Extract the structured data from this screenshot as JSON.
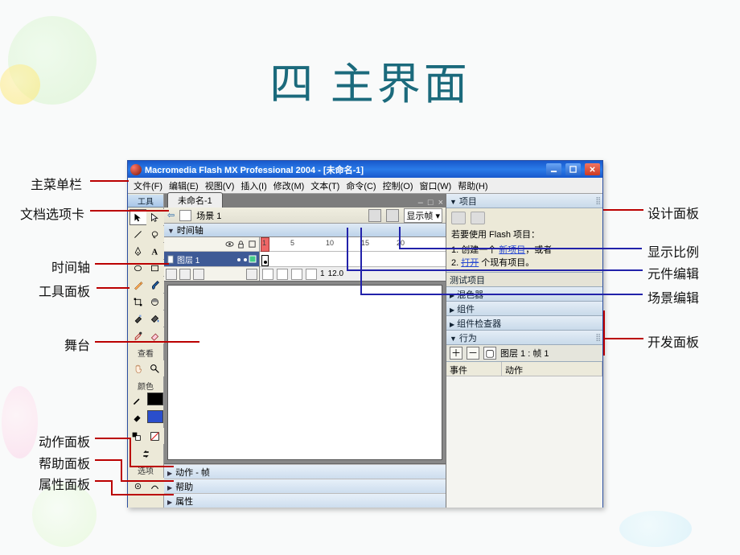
{
  "page_title": "四 主界面",
  "labels": {
    "main_menu": "主菜单栏",
    "doc_tab": "文档选项卡",
    "timeline": "时间轴",
    "tools_panel": "工具面板",
    "stage": "舞台",
    "actions_panel": "动作面板",
    "help_panel": "帮助面板",
    "properties_panel": "属性面板",
    "design_panel": "设计面板",
    "zoom": "显示比例",
    "symbol_edit": "元件编辑",
    "scene_edit": "场景编辑",
    "dev_panel": "开发面板"
  },
  "window": {
    "title": "Macromedia Flash MX Professional 2004 - [未命名-1]",
    "menus": [
      "文件(F)",
      "编辑(E)",
      "视图(V)",
      "插入(I)",
      "修改(M)",
      "文本(T)",
      "命令(C)",
      "控制(O)",
      "窗口(W)",
      "帮助(H)"
    ]
  },
  "tools": {
    "header": "工具",
    "section_view": "查看",
    "section_color": "颜色",
    "section_options": "选项"
  },
  "center": {
    "doc_tab_label": "未命名-1",
    "scene_name": "场景 1",
    "zoom_value": "显示帧",
    "timeline_label": "时间轴",
    "ruler": [
      "1",
      "5",
      "10",
      "15",
      "20"
    ],
    "layer_name": "图层 1",
    "status": {
      "frame": "1",
      "fps": "12.0"
    },
    "actions_label": "动作 - 帧",
    "help_label": "帮助",
    "properties_label": "属性"
  },
  "right": {
    "project": {
      "title": "项目",
      "intro": "若要使用 Flash 项目：",
      "line1_num": "1. ",
      "line1_a": "创建一个 ",
      "line1_link": "新项目",
      "line1_b": "，或者",
      "line2_num": "2. ",
      "line2_link": "打开",
      "line2_b": " 个现有项目。",
      "test_title": "测试项目"
    },
    "panels": {
      "mixer": "混色器",
      "components": "组件",
      "inspector": "组件检查器",
      "behavior": "行为"
    },
    "behavior": {
      "layer_label": "图层 1 : 帧 1",
      "col_event": "事件",
      "col_action": "动作"
    }
  }
}
